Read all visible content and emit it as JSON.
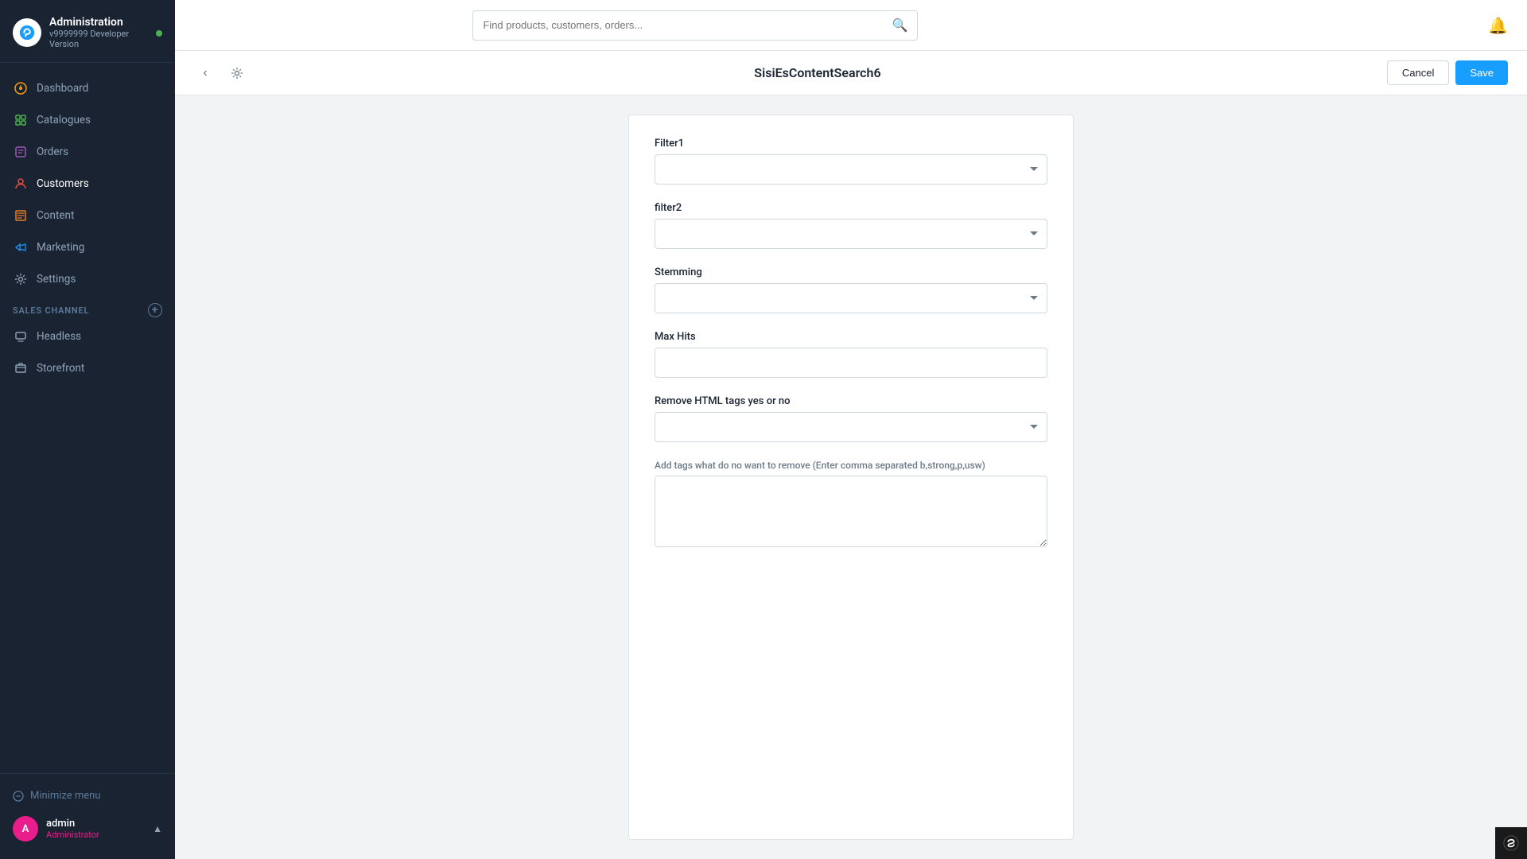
{
  "sidebar": {
    "logo": {
      "title": "Administration",
      "version": "v9999999 Developer Version"
    },
    "nav_items": [
      {
        "id": "dashboard",
        "label": "Dashboard",
        "icon": "dashboard"
      },
      {
        "id": "catalogues",
        "label": "Catalogues",
        "icon": "catalogues"
      },
      {
        "id": "orders",
        "label": "Orders",
        "icon": "orders"
      },
      {
        "id": "customers",
        "label": "Customers",
        "icon": "customers"
      },
      {
        "id": "content",
        "label": "Content",
        "icon": "content"
      },
      {
        "id": "marketing",
        "label": "Marketing",
        "icon": "marketing"
      },
      {
        "id": "settings",
        "label": "Settings",
        "icon": "settings"
      }
    ],
    "sales_channel": {
      "label": "Sales Channel",
      "items": [
        {
          "id": "headless",
          "label": "Headless"
        },
        {
          "id": "storefront",
          "label": "Storefront"
        }
      ]
    },
    "minimize_label": "Minimize menu",
    "user": {
      "name": "admin",
      "role": "Administrator",
      "initial": "A"
    }
  },
  "topbar": {
    "search_placeholder": "Find products, customers, orders..."
  },
  "page_header": {
    "title": "SisiEsContentSearch6",
    "cancel_label": "Cancel",
    "save_label": "Save"
  },
  "form": {
    "filter1_label": "Filter1",
    "filter2_label": "filter2",
    "stemming_label": "Stemming",
    "max_hits_label": "Max Hits",
    "remove_html_label": "Remove HTML tags yes or no",
    "add_tags_label": "Add tags what do no want to remove (Enter comma separated b,strong,p,usw)"
  }
}
